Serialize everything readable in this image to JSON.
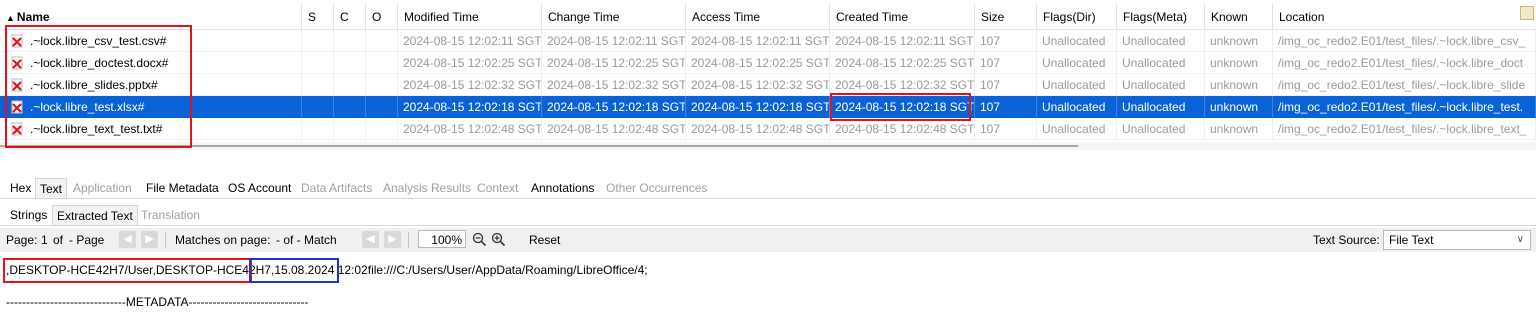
{
  "table": {
    "columns": [
      "Name",
      "S",
      "C",
      "O",
      "Modified Time",
      "Change Time",
      "Access Time",
      "Created Time",
      "Size",
      "Flags(Dir)",
      "Flags(Meta)",
      "Known",
      "Location"
    ],
    "rows": [
      {
        "name": ".~lock.libre_csv_test.csv#",
        "mod": "2024-08-15 12:02:11 SGT",
        "chg": "2024-08-15 12:02:11 SGT",
        "acc": "2024-08-15 12:02:11 SGT",
        "cre": "2024-08-15 12:02:11 SGT",
        "size": "107",
        "fd": "Unallocated",
        "fm": "Unallocated",
        "known": "unknown",
        "loc": "/img_oc_redo2.E01/test_files/.~lock.libre_csv_"
      },
      {
        "name": ".~lock.libre_doctest.docx#",
        "mod": "2024-08-15 12:02:25 SGT",
        "chg": "2024-08-15 12:02:25 SGT",
        "acc": "2024-08-15 12:02:25 SGT",
        "cre": "2024-08-15 12:02:25 SGT",
        "size": "107",
        "fd": "Unallocated",
        "fm": "Unallocated",
        "known": "unknown",
        "loc": "/img_oc_redo2.E01/test_files/.~lock.libre_doct"
      },
      {
        "name": ".~lock.libre_slides.pptx#",
        "mod": "2024-08-15 12:02:32 SGT",
        "chg": "2024-08-15 12:02:32 SGT",
        "acc": "2024-08-15 12:02:32 SGT",
        "cre": "2024-08-15 12:02:32 SGT",
        "size": "107",
        "fd": "Unallocated",
        "fm": "Unallocated",
        "known": "unknown",
        "loc": "/img_oc_redo2.E01/test_files/.~lock.libre_slide"
      },
      {
        "name": ".~lock.libre_test.xlsx#",
        "mod": "2024-08-15 12:02:18 SGT",
        "chg": "2024-08-15 12:02:18 SGT",
        "acc": "2024-08-15 12:02:18 SGT",
        "cre": "2024-08-15 12:02:18 SGT",
        "size": "107",
        "fd": "Unallocated",
        "fm": "Unallocated",
        "known": "unknown",
        "loc": "/img_oc_redo2.E01/test_files/.~lock.libre_test."
      },
      {
        "name": ".~lock.libre_text_test.txt#",
        "mod": "2024-08-15 12:02:48 SGT",
        "chg": "2024-08-15 12:02:48 SGT",
        "acc": "2024-08-15 12:02:48 SGT",
        "cre": "2024-08-15 12:02:48 SGT",
        "size": "107",
        "fd": "Unallocated",
        "fm": "Unallocated",
        "known": "unknown",
        "loc": "/img_oc_redo2.E01/test_files/.~lock.libre_text_"
      }
    ]
  },
  "tabs": {
    "main": [
      "Hex",
      "Text",
      "Application",
      "File Metadata",
      "OS Account",
      "Data Artifacts",
      "Analysis Results",
      "Context",
      "Annotations",
      "Other Occurrences"
    ],
    "sub": [
      "Strings",
      "Extracted Text",
      "Translation"
    ]
  },
  "toolbar": {
    "page_label": "Page:",
    "page_num": "1",
    "of_label": "of",
    "page_word": "-  Page",
    "matches_label": "Matches on page:",
    "matches_value": "-  of  -  Match",
    "zoom": "100%",
    "reset": "Reset",
    "text_source_label": "Text Source:",
    "text_source_value": "File Text"
  },
  "content": {
    "part1": ",DESKTOP-HCE42H7/User,DESKTOP-HCE42H7,",
    "part2": "15.08.2024 12:02",
    "part3": "file:///C:/Users/User/AppData/Roaming/LibreOffice/4;",
    "line2": "------------------------------METADATA------------------------------"
  },
  "colors": {
    "selection": "#0a63d6",
    "highlight_red": "#e0141e",
    "highlight_blue": "#2134c7"
  }
}
